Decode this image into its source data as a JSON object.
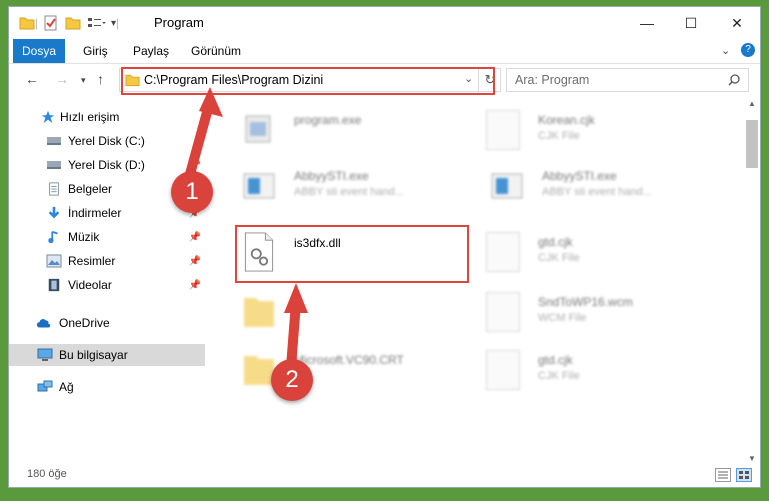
{
  "window": {
    "title": "Program",
    "controls": {
      "minimize": "—",
      "maximize": "☐",
      "close": "✕"
    }
  },
  "ribbon": {
    "tabs": [
      "Dosya",
      "Giriş",
      "Paylaş",
      "Görünüm"
    ]
  },
  "navigation": {
    "address": "C:\\Program Files\\Program Dizini",
    "search_placeholder": "Ara: Program"
  },
  "sidebar": {
    "items": [
      {
        "label": "Hızlı erişim",
        "icon": "star-icon"
      },
      {
        "label": "Yerel Disk (C:)",
        "icon": "drive-icon"
      },
      {
        "label": "Yerel Disk (D:)",
        "icon": "drive-icon"
      },
      {
        "label": "Belgeler",
        "icon": "documents-icon"
      },
      {
        "label": "İndirmeler",
        "icon": "download-icon"
      },
      {
        "label": "Müzik",
        "icon": "music-icon"
      },
      {
        "label": "Resimler",
        "icon": "pictures-icon"
      },
      {
        "label": "Videolar",
        "icon": "videos-icon"
      },
      {
        "label": "OneDrive",
        "icon": "cloud-icon"
      },
      {
        "label": "Bu bilgisayar",
        "icon": "computer-icon"
      },
      {
        "label": "Ağ",
        "icon": "network-icon"
      }
    ]
  },
  "files": [
    {
      "name": "program.exe",
      "sub": ""
    },
    {
      "name": "Korean.cjk",
      "sub": "CJK File"
    },
    {
      "name": "AbbyySTI.exe",
      "sub": "ABBY sti event hand..."
    },
    {
      "name": "AbbyySTI.exe",
      "sub": "ABBY sti event hand..."
    },
    {
      "name": "is3dfx.dll",
      "sub": ""
    },
    {
      "name": "gtd.cjk",
      "sub": "CJK File"
    },
    {
      "name": "",
      "sub": ""
    },
    {
      "name": "SndToWP16.wcm",
      "sub": "WCM File"
    },
    {
      "name": "Microsoft.VC90.CRT",
      "sub": ""
    },
    {
      "name": "gtd.cjk",
      "sub": "CJK File"
    }
  ],
  "status": {
    "count": "180 öğe"
  },
  "annotations": {
    "badge1": "1",
    "badge2": "2"
  },
  "colors": {
    "accent": "#1979ca",
    "highlight": "#e0443e"
  }
}
